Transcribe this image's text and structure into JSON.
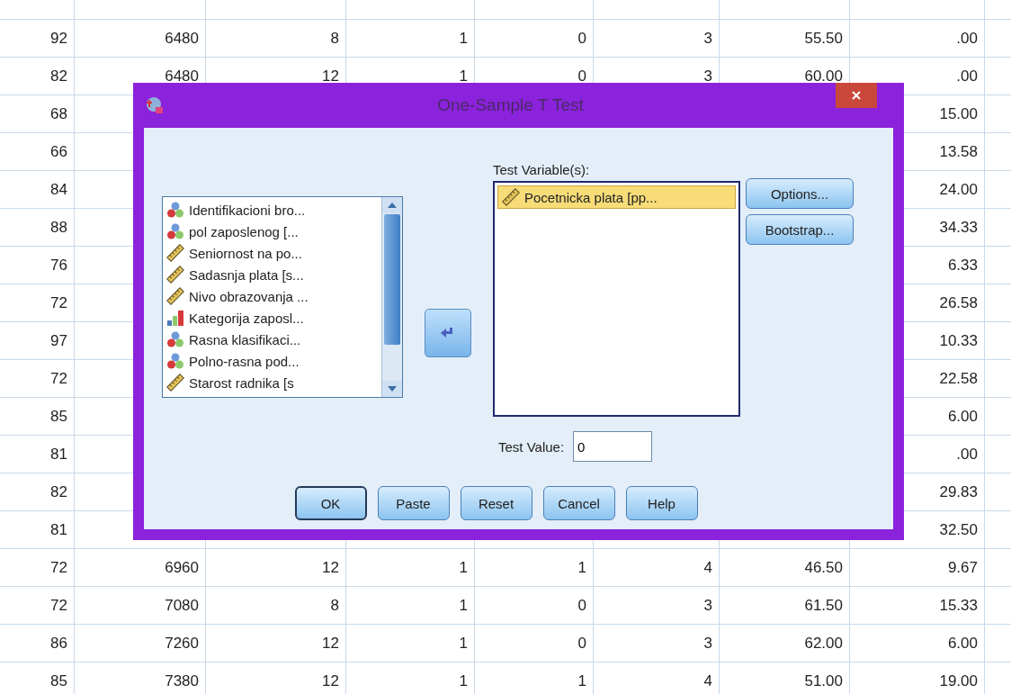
{
  "table": {
    "rows": [
      {
        "cells": [
          "92",
          "6480",
          "8",
          "1",
          "0",
          "3",
          "55.50",
          ".00"
        ]
      },
      {
        "cells": [
          "82",
          "6480",
          "12",
          "1",
          "0",
          "3",
          "60.00",
          ".00"
        ]
      },
      {
        "cells": [
          "68",
          null,
          null,
          null,
          null,
          null,
          null,
          "15.00"
        ]
      },
      {
        "cells": [
          "66",
          null,
          null,
          null,
          null,
          null,
          null,
          "13.58"
        ]
      },
      {
        "cells": [
          "84",
          null,
          null,
          null,
          null,
          null,
          null,
          "24.00"
        ]
      },
      {
        "cells": [
          "88",
          null,
          null,
          null,
          null,
          null,
          null,
          "34.33"
        ]
      },
      {
        "cells": [
          "76",
          null,
          null,
          null,
          null,
          null,
          null,
          "6.33"
        ]
      },
      {
        "cells": [
          "72",
          null,
          null,
          null,
          null,
          null,
          null,
          "26.58"
        ]
      },
      {
        "cells": [
          "97",
          null,
          null,
          null,
          null,
          null,
          null,
          "10.33"
        ]
      },
      {
        "cells": [
          "72",
          null,
          null,
          null,
          null,
          null,
          null,
          "22.58"
        ]
      },
      {
        "cells": [
          "85",
          null,
          null,
          null,
          null,
          null,
          null,
          "6.00"
        ]
      },
      {
        "cells": [
          "81",
          null,
          null,
          null,
          null,
          null,
          null,
          ".00"
        ]
      },
      {
        "cells": [
          "82",
          null,
          null,
          null,
          null,
          null,
          null,
          "29.83"
        ]
      },
      {
        "cells": [
          "81",
          null,
          null,
          null,
          null,
          null,
          null,
          "32.50"
        ]
      },
      {
        "cells": [
          "72",
          "6960",
          "12",
          "1",
          "1",
          "4",
          "46.50",
          "9.67"
        ]
      },
      {
        "cells": [
          "72",
          "7080",
          "8",
          "1",
          "0",
          "3",
          "61.50",
          "15.33"
        ]
      },
      {
        "cells": [
          "86",
          "7260",
          "12",
          "1",
          "0",
          "3",
          "62.00",
          "6.00"
        ]
      },
      {
        "cells": [
          "85",
          "7380",
          "12",
          "1",
          "1",
          "4",
          "51.00",
          "19.00"
        ]
      }
    ]
  },
  "dialog": {
    "title": "One-Sample T Test",
    "variables": [
      {
        "label": "Identifikacioni bro...",
        "kind": "nominal"
      },
      {
        "label": "pol zaposlenog [...",
        "kind": "nominal"
      },
      {
        "label": "Seniornost na po...",
        "kind": "scale"
      },
      {
        "label": "Sadasnja plata [s...",
        "kind": "scale"
      },
      {
        "label": "Nivo obrazovanja ...",
        "kind": "scale"
      },
      {
        "label": "Kategorija zaposl...",
        "kind": "ordinal"
      },
      {
        "label": "Rasna klasifikaci...",
        "kind": "nominal"
      },
      {
        "label": "Polno-rasna pod...",
        "kind": "nominal"
      },
      {
        "label": "Starost radnika [s",
        "kind": "scale"
      }
    ],
    "test_variables_label": "Test Variable(s):",
    "test_variables": [
      {
        "label": "Pocetnicka plata [pp...",
        "kind": "scale",
        "selected": true
      }
    ],
    "side_buttons": [
      "Options...",
      "Bootstrap..."
    ],
    "test_value": {
      "label": "Test Value:",
      "value": "0"
    },
    "buttons": [
      {
        "label": "OK",
        "default": true
      },
      {
        "label": "Paste",
        "default": false
      },
      {
        "label": "Reset",
        "default": false
      },
      {
        "label": "Cancel",
        "default": false
      },
      {
        "label": "Help",
        "default": false
      }
    ]
  }
}
